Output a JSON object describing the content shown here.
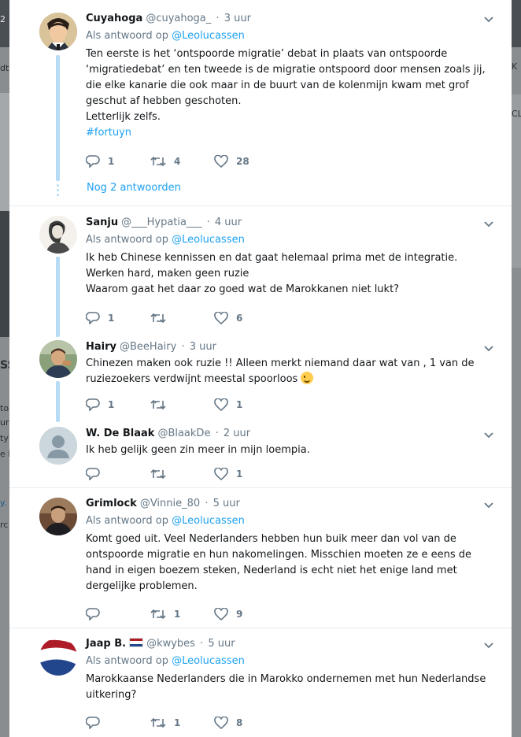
{
  "tweets": [
    {
      "name": "Cuyahoga",
      "handle": "@cuyahoga_",
      "time": "3 uur",
      "reply_prefix": "Als antwoord op",
      "reply_mention": "@Leolucassen",
      "text": "Ten eerste is het ‘ontspoorde migratie’ debat in plaats van ontspoorde ‘migratiedebat’ en ten tweede is de migratie ontspoord door mensen zoals jij, die elke kanarie die ook maar in de buurt van de kolenmijn kwam met grof geschut af hebben geschoten.\nLetterlijk zelfs.",
      "hashtag": "#fortuyn",
      "replies": "1",
      "retweets": "4",
      "likes": "28",
      "more_replies": "Nog 2 antwoorden"
    },
    {
      "name": "Sanju",
      "handle": "@___Hypatia___",
      "time": "4 uur",
      "reply_prefix": "Als antwoord op",
      "reply_mention": "@Leolucassen",
      "text": "Ik heb Chinese kennissen en dat gaat helemaal prima met de integratie. Werken hard, maken geen ruzie\n Waarom gaat het daar zo goed wat de Marokkanen niet lukt?",
      "replies": "1",
      "retweets": "",
      "likes": "6"
    },
    {
      "name": "Hairy",
      "handle": "@BeeHairy",
      "time": "3 uur",
      "text": "Chinezen maken ook ruzie !! Alleen merkt niemand daar wat van , 1 van de ruziezoekers verdwijnt meestal spoorloos",
      "replies": "1",
      "retweets": "",
      "likes": "1"
    },
    {
      "name": "W. De Blaak",
      "handle": "@BlaakDe",
      "time": "2 uur",
      "text": "Ik heb gelijk geen zin meer in mijn loempia.",
      "replies": "",
      "retweets": "",
      "likes": "1"
    },
    {
      "name": "Grimlock",
      "handle": "@Vinnie_80",
      "time": "5 uur",
      "reply_prefix": "Als antwoord op",
      "reply_mention": "@Leolucassen",
      "text": "Komt goed uit. Veel Nederlanders hebben hun buik meer dan vol van de ontspoorde migratie en hun nakomelingen. Misschien moeten ze e eens de hand in eigen boezem steken, Nederland is echt niet het enige land met dergelijke problemen.",
      "replies": "",
      "retweets": "1",
      "likes": "9"
    },
    {
      "name": "Jaap B.",
      "handle": "@kwybes",
      "time": "5 uur",
      "reply_prefix": "Als antwoord op",
      "reply_mention": "@Leolucassen",
      "text": "Marokkaanse Nederlanders die in Marokko ondernemen met hun Nederlandse uitkering?",
      "replies": "",
      "retweets": "1",
      "likes": "8"
    }
  ],
  "icons": {
    "reply": "reply-icon",
    "retweet": "retweet-icon",
    "like": "heart-icon",
    "menu": "chevron-down-icon"
  },
  "colors": {
    "link": "#1da1f2",
    "thread_line": "#b6dcf6",
    "muted": "#657786",
    "text": "#14171a"
  },
  "background": {
    "left_fragments": [
      "2",
      "dt",
      "SS",
      "to",
      "ur",
      "ty",
      "e l",
      "y.",
      "rc"
    ],
    "right_fragments": [
      "K",
      "CL"
    ]
  }
}
